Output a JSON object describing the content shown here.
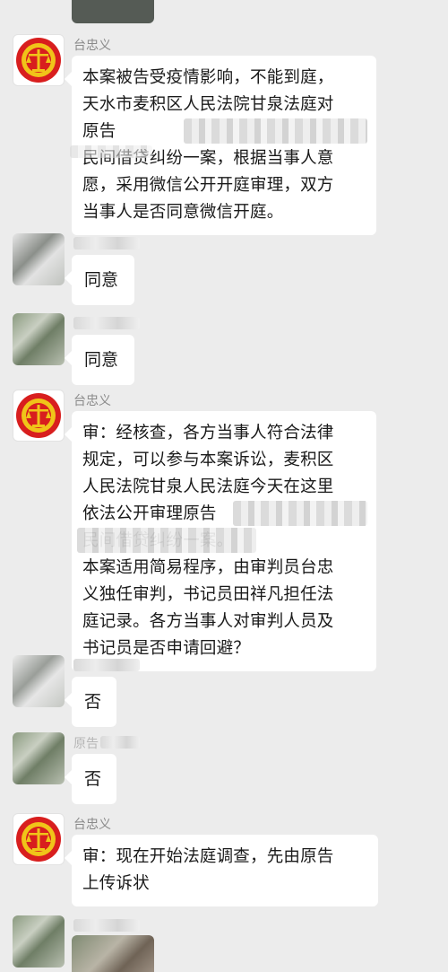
{
  "colors": {
    "background": "#ececec",
    "bubble": "#ffffff",
    "sender_name": "#8a8a8a",
    "seal_red": "#d81e1e",
    "seal_gold": "#f0c419"
  },
  "icons": {
    "court_avatar": "court-emblem-icon"
  },
  "messages": [
    {
      "sender": "台忠义",
      "text": "本案被告受疫情影响，不能到庭，\n天水市麦积区人民法院甘泉法庭对\n原告\n民间借贷纠纷一案，根据当事人意\n愿，采用微信公开开庭审理，双方\n当事人是否同意微信开庭。"
    },
    {
      "sender": "",
      "text": "同意"
    },
    {
      "sender": "",
      "text": "同意"
    },
    {
      "sender": "台忠义",
      "text": "审：经核查，各方当事人符合法律\n规定，可以参与本案诉讼，麦积区\n人民法院甘泉人民法庭今天在这里\n依法公开审理原告\n民间借贷纠纷一案。\n本案适用简易程序，由审判员台忠\n义独任审判，书记员田祥凡担任法\n庭记录。各方当事人对审判人员及\n书记员是否申请回避？"
    },
    {
      "sender": "",
      "text": "否"
    },
    {
      "sender": "原告",
      "text": "否"
    },
    {
      "sender": "台忠义",
      "text": "审：现在开始法庭调查，先由原告\n上传诉状"
    }
  ]
}
